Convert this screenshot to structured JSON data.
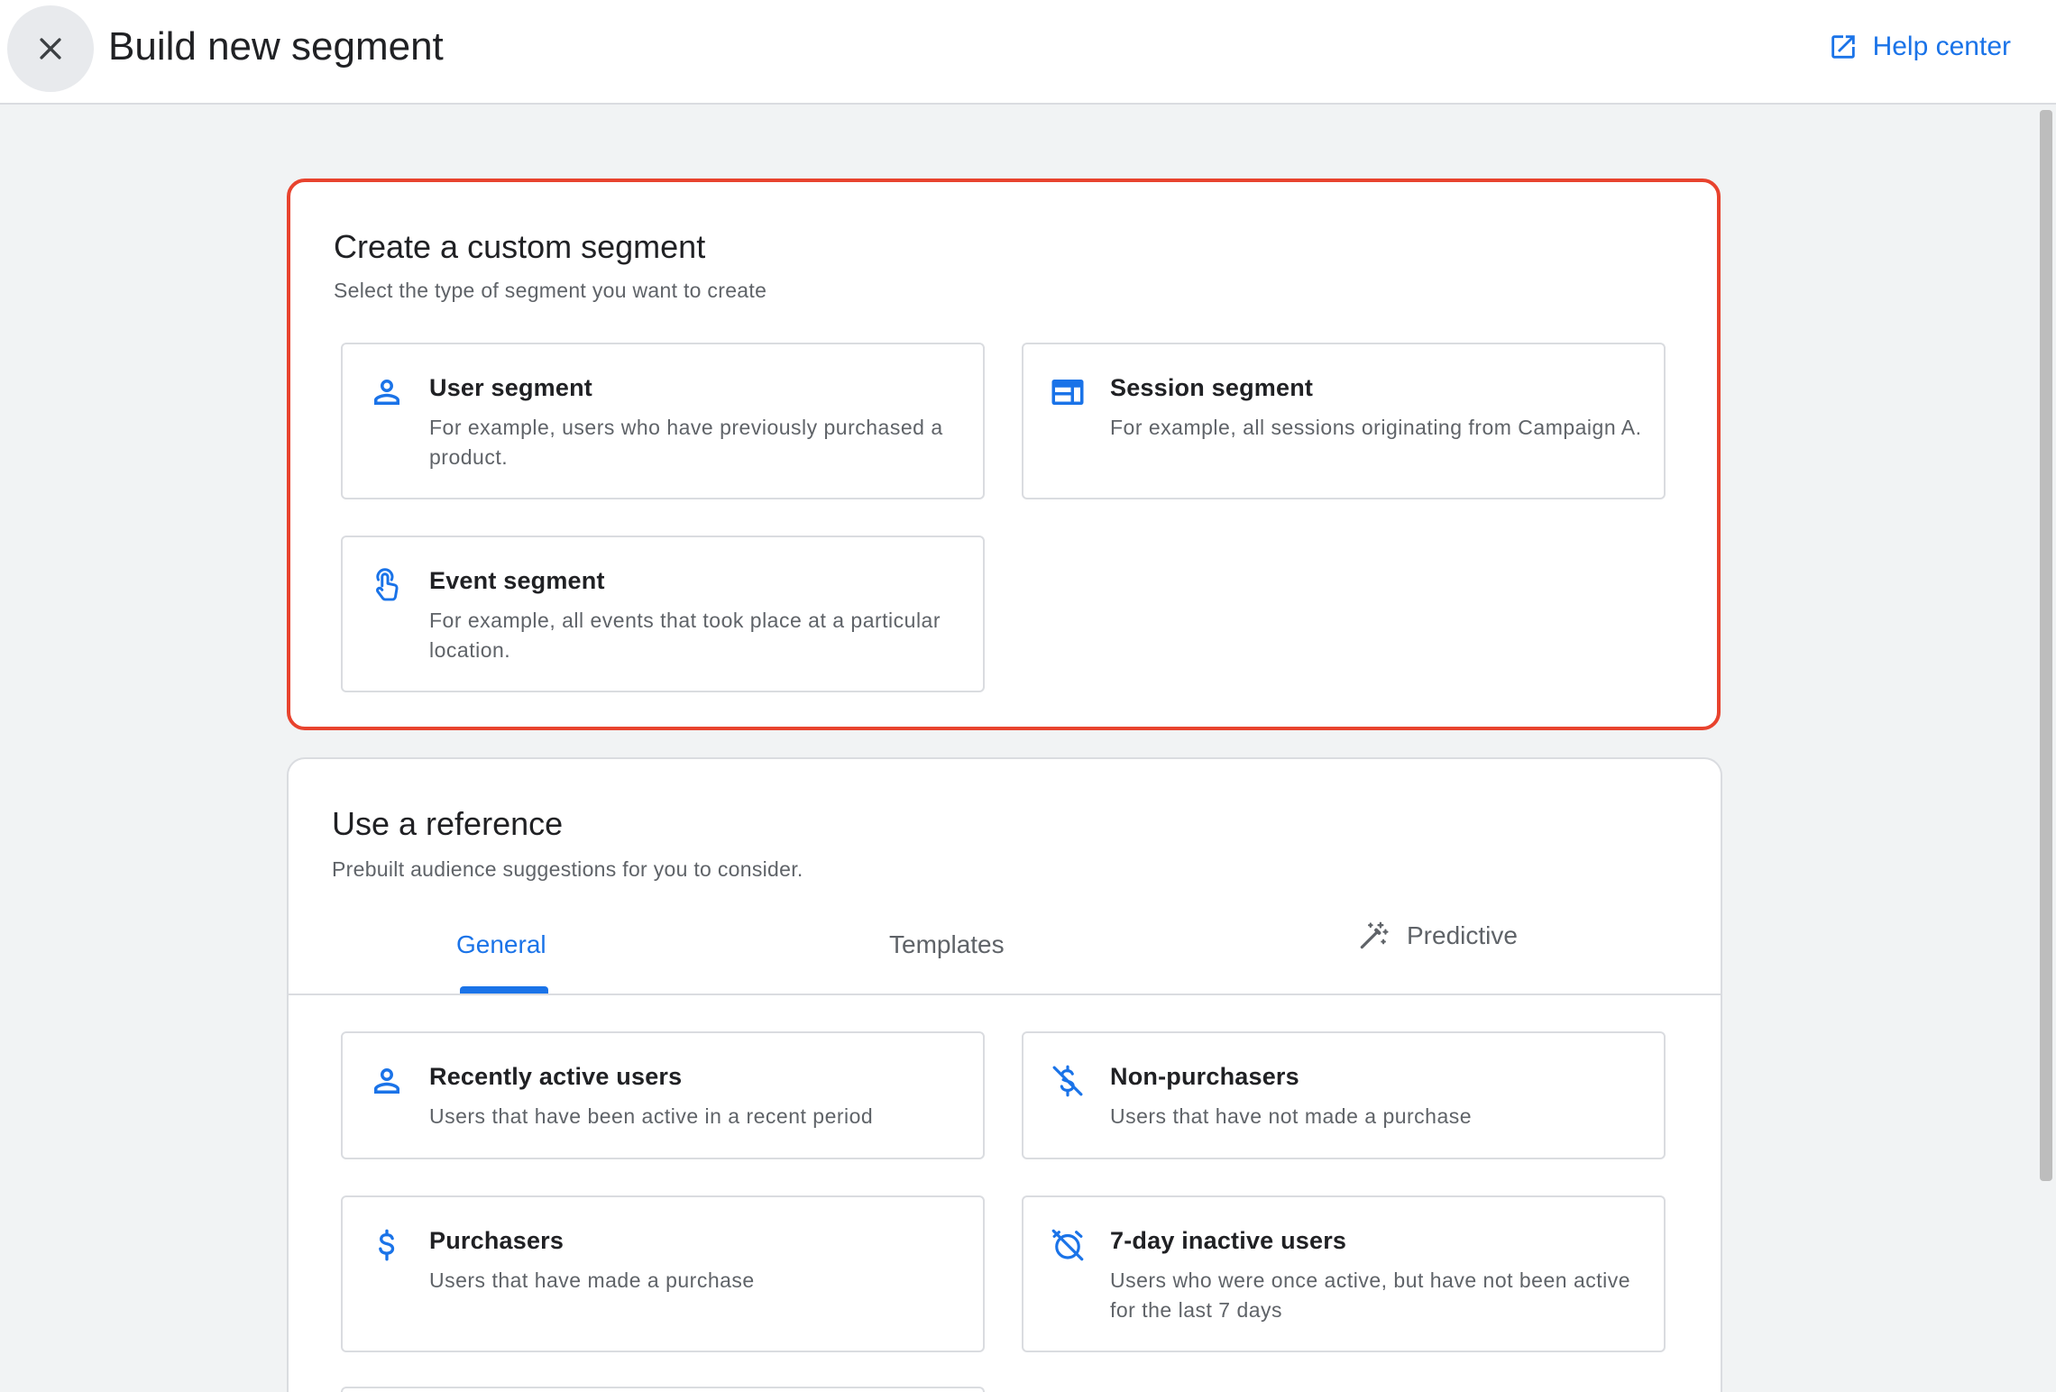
{
  "header": {
    "title": "Build new segment",
    "close_icon": "close-icon",
    "help_label": "Help center",
    "help_icon": "open-in-new-icon"
  },
  "custom_segment": {
    "title": "Create a custom segment",
    "subtitle": "Select the type of segment you want to create",
    "highlight_color": "#e8432e",
    "cards": [
      {
        "icon": "person-icon",
        "title": "User segment",
        "description": "For example, users who have previously purchased a product."
      },
      {
        "icon": "web-session-icon",
        "title": "Session segment",
        "description": "For example, all sessions originating from Campaign A."
      },
      {
        "icon": "touch-icon",
        "title": "Event segment",
        "description": "For example, all events that took place at a particular location."
      }
    ]
  },
  "reference": {
    "title": "Use a reference",
    "subtitle": "Prebuilt audience suggestions for you to consider.",
    "tabs": [
      {
        "label": "General",
        "active": true
      },
      {
        "label": "Templates",
        "active": false
      },
      {
        "label": "Predictive",
        "active": false,
        "icon": "magic-wand-icon"
      }
    ],
    "cards": [
      {
        "icon": "person-icon",
        "title": "Recently active users",
        "description": "Users that have been active in a recent period"
      },
      {
        "icon": "money-off-icon",
        "title": "Non-purchasers",
        "description": "Users that have not made a purchase"
      },
      {
        "icon": "dollar-icon",
        "title": "Purchasers",
        "description": "Users that have made a purchase"
      },
      {
        "icon": "alarm-off-icon",
        "title": "7-day inactive users",
        "description": "Users who were once active, but have not been active for the last 7 days"
      }
    ]
  },
  "colors": {
    "accent": "#1a73e8",
    "text_primary": "#202124",
    "text_secondary": "#5f6368",
    "border": "#dadce0",
    "background": "#f1f3f4"
  }
}
